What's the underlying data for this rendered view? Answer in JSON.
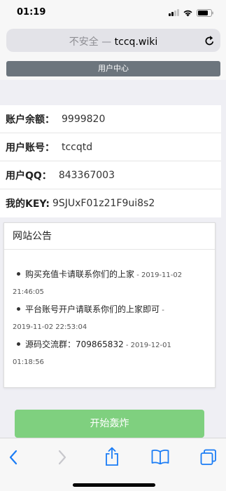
{
  "status_bar": {
    "time": "01:19"
  },
  "browser": {
    "insecure_label": "不安全",
    "separator": "—",
    "domain": "tccq.wiki"
  },
  "nav": {
    "user_center_label": "用户中心"
  },
  "account": {
    "rows": [
      {
        "label": "账户余额：",
        "value": "9999820"
      },
      {
        "label": "用户账号：",
        "value": "tccqtd"
      },
      {
        "label": "用户QQ：",
        "value": "843367003"
      },
      {
        "label": "我的KEY:",
        "value": "9SJUxF01z21F9ui8s2"
      }
    ]
  },
  "announcements": {
    "title": "网站公告",
    "items": [
      {
        "text": "购买充值卡请联系你们的上家",
        "date_part1": " - 2019-11-02",
        "date_part2": "21:46:05"
      },
      {
        "text": "平台账号开户请联系你们的上家即可",
        "date_part1": " -",
        "date_part2": "2019-11-02 22:53:04"
      },
      {
        "text": "源码交流群：709865832",
        "date_part1": " - 2019-12-01",
        "date_part2": "01:18:56"
      }
    ]
  },
  "actions": {
    "start_label": "开始轰炸"
  },
  "colors": {
    "nav_button": "#6c757d",
    "start_button": "#7fd07f",
    "toolbar_icon": "#1a7cf5",
    "toolbar_icon_disabled": "#c7c7cc"
  },
  "toolbar": {
    "icons": [
      "back-icon",
      "forward-icon",
      "share-icon",
      "bookmarks-icon",
      "tabs-icon"
    ]
  }
}
